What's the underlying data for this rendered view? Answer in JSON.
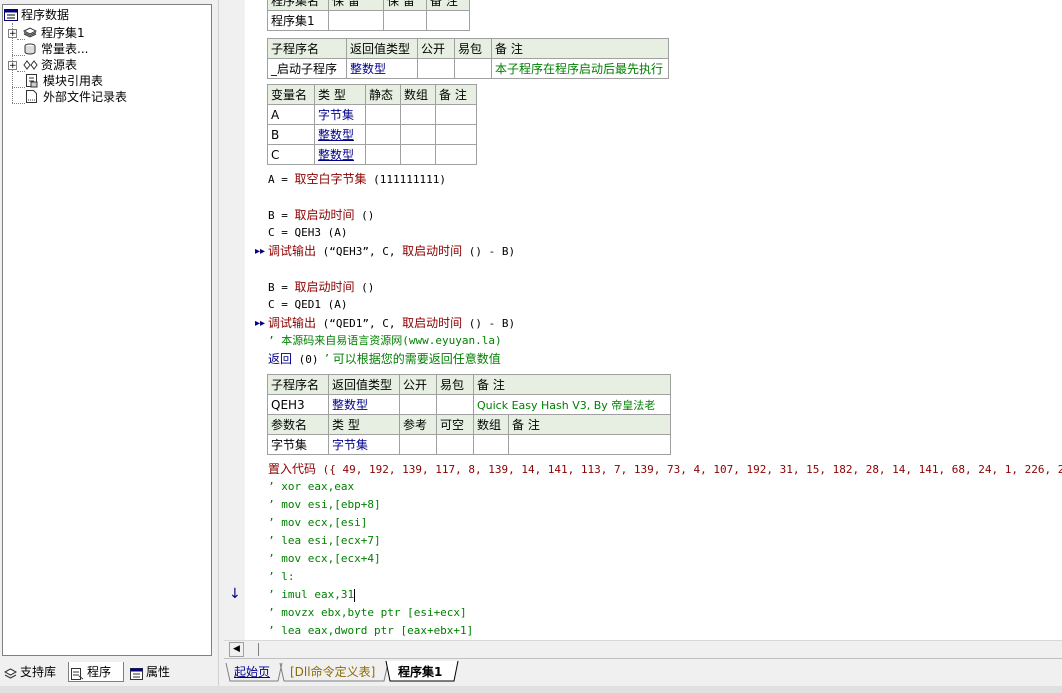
{
  "tree": {
    "root": "程序数据",
    "items": [
      {
        "label": "程序集1",
        "icon": "program-set-icon"
      },
      {
        "label": "常量表...",
        "icon": "constant-table-icon"
      },
      {
        "label": "资源表",
        "icon": "resource-table-icon"
      },
      {
        "label": "模块引用表",
        "icon": "module-reference-icon"
      },
      {
        "label": "外部文件记录表",
        "icon": "external-file-icon"
      }
    ]
  },
  "left_tabs": [
    "支持库",
    "程序",
    "属性"
  ],
  "top_table": {
    "headers": [
      "程序集名",
      "保 留",
      "保 留",
      "备 注"
    ],
    "row": [
      "程序集1",
      "",
      "",
      ""
    ]
  },
  "sub1": {
    "headers": [
      "子程序名",
      "返回值类型",
      "公开",
      "易包",
      "备 注"
    ],
    "row": [
      "_启动子程序",
      "整数型",
      "",
      "",
      "本子程序在程序启动后最先执行"
    ]
  },
  "vars": {
    "headers": [
      "变量名",
      "类 型",
      "静态",
      "数组",
      "备 注"
    ],
    "rows": [
      [
        "A",
        "字节集",
        "",
        "",
        ""
      ],
      [
        "B",
        "整数型",
        "",
        "",
        ""
      ],
      [
        "C",
        "整数型",
        "",
        "",
        ""
      ]
    ]
  },
  "code": {
    "l1_var": "A =",
    "l1_fn": "取空白字节集",
    "l1_args": "(111111111)",
    "l2_var": "B =",
    "l2_fn": "取启动时间",
    "l2_args": "()",
    "l3": "C = QEH3 (A)",
    "l4_fn": "调试输出",
    "l4_mid": "(“QEH3”, C,",
    "l4_fn2": "取启动时间",
    "l4_end": "() - B)",
    "l5_var": "B =",
    "l5_fn": "取启动时间",
    "l5_args": "()",
    "l6": "C = QED1 (A)",
    "l7_fn": "调试输出",
    "l7_mid": "(“QED1”, C,",
    "l7_fn2": "取启动时间",
    "l7_end": "() - B)",
    "l8_comment": "’ 本源码来自易语言资源网(www.eyuyan.la)",
    "l9_kw": "返回",
    "l9_args": "(0)",
    "l9_comment": "’ 可以根据您的需要返回任意数值"
  },
  "sub2": {
    "headers": [
      "子程序名",
      "返回值类型",
      "公开",
      "易包",
      "备 注"
    ],
    "row": [
      "QEH3",
      "整数型",
      "",
      "",
      "Quick Easy Hash V3, By 帝皇法老"
    ],
    "param_headers": [
      "参数名",
      "类 型",
      "参考",
      "可空",
      "数组",
      "备 注"
    ],
    "param_row": [
      "字节集",
      "字节集",
      "",
      "",
      "",
      ""
    ]
  },
  "asm": {
    "fn": "置入代码",
    "args": "({ 49, 192, 139, 117, 8, 139, 14, 141, 113, 7, 139, 73, 4, 107, 192, 31, 15, 182, 28, 14, 141, 68, 24, 1, 226, 243, 201, 194",
    "lines": [
      "’ xor eax,eax",
      "’ mov esi,[ebp+8]",
      "’ mov ecx,[esi]",
      "’ lea esi,[ecx+7]",
      "’ mov ecx,[ecx+4]",
      "’ l:",
      "’ imul eax,31",
      "’ movzx ebx,byte ptr [esi+ecx]",
      "’ lea eax,dword ptr [eax+ebx+1]"
    ]
  },
  "doc_tabs": [
    "起始页",
    "[Dll命令定义表]",
    "程序集1"
  ],
  "colors": {
    "header_bg": "#e7efe2",
    "type_blue": "#00008b",
    "comment_green": "#008000",
    "keyword_red": "#8b0000"
  }
}
